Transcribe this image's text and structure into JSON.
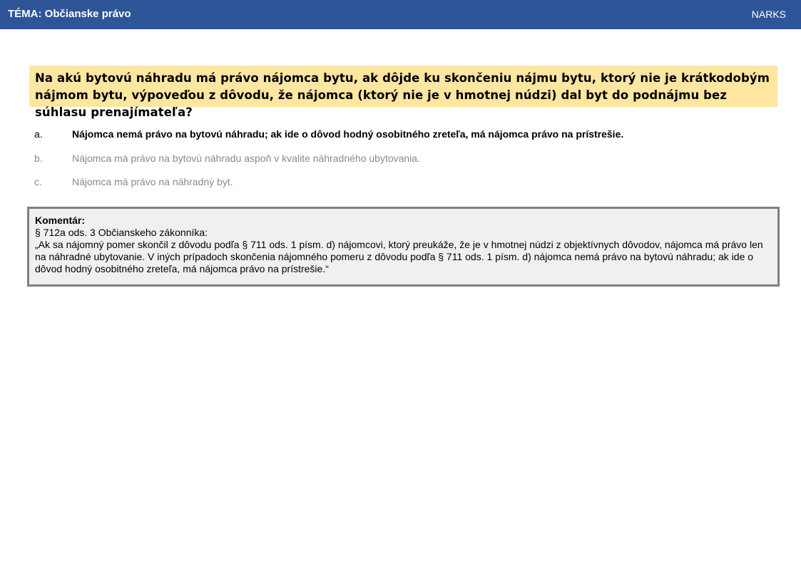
{
  "header": {
    "topic": "TÉMA: Občianske právo",
    "brand": "NARKS",
    "bg_color": "#2e5597"
  },
  "question": {
    "text": "Na akú bytovú náhradu má právo nájomca bytu, ak dôjde ku skončeniu nájmu bytu, ktorý nie je krátkodobým nájmom bytu, výpoveďou z dôvodu, že nájomca (ktorý nie je v hmotnej núdzi) dal byt do podnájmu bez súhlasu prenajímateľa?",
    "bg_color": "#ffe6a1"
  },
  "answers": [
    {
      "letter": "a.",
      "text": "Nájomca nemá právo na bytovú náhradu; ak ide o dôvod hodný osobitného zreteľa, má nájomca právo na prístrešie.",
      "correct": true
    },
    {
      "letter": "b.",
      "text": "Nájomca má právo na bytovú náhradu aspoň v kvalite náhradného ubytovania.",
      "correct": false
    },
    {
      "letter": "c.",
      "text": "Nájomca má právo na náhradný byt.",
      "correct": false
    }
  ],
  "comment": {
    "title": "Komentár:",
    "source": "§ 712a ods. 3 Občianskeho zákonníka:",
    "quote": "„Ak sa nájomný pomer skončil z dôvodu podľa § 711 ods. 1 písm. d) nájomcovi, ktorý preukáže, že je v hmotnej núdzi z objektívnych dôvodov, nájomca má právo len na náhradné ubytovanie. V iných prípadoch skončenia nájomného pomeru z dôvodu podľa § 711 ods. 1 písm. d) nájomca nemá právo na bytovú náhradu; ak ide o dôvod hodný osobitného zreteľa, má nájomca právo na prístrešie.“"
  }
}
